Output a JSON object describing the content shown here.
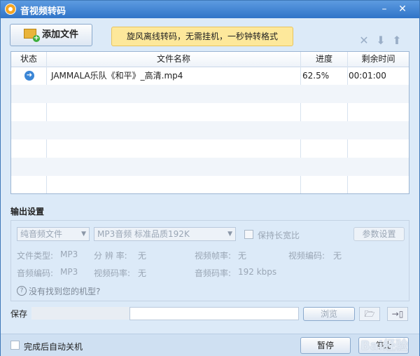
{
  "window": {
    "title": "音视频转码"
  },
  "toolbar": {
    "add_file_label": "添加文件",
    "promo_text": "旋风离线转码，无需挂机，一秒钟转格式"
  },
  "file_list": {
    "columns": [
      "状态",
      "文件名称",
      "进度",
      "剩余时间"
    ],
    "rows": [
      {
        "file_name": "JAMMALA乐队《和平》_高清.mp4",
        "progress": "62.5%",
        "remaining": "00:01:00"
      }
    ]
  },
  "output": {
    "section_title": "输出设置",
    "format_select": "纯音频文件",
    "quality_select": "MP3音频 标准品质192K",
    "keep_ratio_label": "保持长宽比",
    "params_button": "参数设置",
    "info": {
      "file_type_label": "文件类型:",
      "file_type": "MP3",
      "resolution_label": "分 辨 率:",
      "resolution": "无",
      "video_fps_label": "视频帧率:",
      "video_fps": "无",
      "video_codec_label": "视频编码:",
      "video_codec": "无",
      "audio_codec_label": "音频编码:",
      "audio_codec": "MP3",
      "video_bitrate_label": "视频码率:",
      "video_bitrate": "无",
      "audio_bitrate_label": "音频码率:",
      "audio_bitrate": "192 kbps"
    },
    "help_link": "没有找到您的机型?"
  },
  "save": {
    "label": "保存",
    "browse_label": "浏览"
  },
  "bottom": {
    "auto_shutdown_label": "完成后自动关机",
    "pause_label": "暂停",
    "stop_label": "停止",
    "watermark": "Bai经验"
  }
}
